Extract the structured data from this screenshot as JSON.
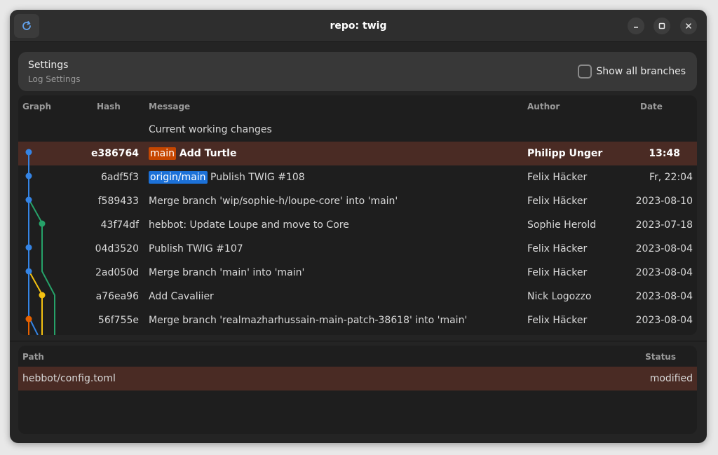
{
  "window": {
    "title": "repo: twig"
  },
  "settings": {
    "title": "Settings",
    "subtitle": "Log Settings",
    "show_all_branches_label": "Show all branches",
    "show_all_branches_checked": false
  },
  "log": {
    "columns": {
      "graph": "Graph",
      "hash": "Hash",
      "message": "Message",
      "author": "Author",
      "date": "Date"
    },
    "working_changes": "Current working changes",
    "rows": [
      {
        "hash": "e386764",
        "ref": "main",
        "message": "Add Turtle",
        "author": "Philipp Unger",
        "date": "13:48",
        "selected": true
      },
      {
        "hash": "6adf5f3",
        "ref": "origin/main",
        "message": "Publish TWIG #108",
        "author": "Felix Häcker",
        "date": "Fr, 22:04"
      },
      {
        "hash": "f589433",
        "ref": "",
        "message": "Merge branch 'wip/sophie-h/loupe-core' into 'main'",
        "author": "Felix Häcker",
        "date": "2023-08-10"
      },
      {
        "hash": "43f74df",
        "ref": "",
        "message": "hebbot: Update Loupe and move to Core",
        "author": "Sophie Herold",
        "date": "2023-07-18"
      },
      {
        "hash": "04d3520",
        "ref": "",
        "message": "Publish TWIG #107",
        "author": "Felix Häcker",
        "date": "2023-08-04"
      },
      {
        "hash": "2ad050d",
        "ref": "",
        "message": "Merge branch 'main' into 'main'",
        "author": "Felix Häcker",
        "date": "2023-08-04"
      },
      {
        "hash": "a76ea96",
        "ref": "",
        "message": "Add Cavaliier",
        "author": "Nick Logozzo",
        "date": "2023-08-04"
      },
      {
        "hash": "56f755e",
        "ref": "",
        "message": "Merge branch 'realmazharhussain-main-patch-38618' into 'main'",
        "author": "Felix Häcker",
        "date": "2023-08-04"
      }
    ]
  },
  "files": {
    "columns": {
      "path": "Path",
      "status": "Status"
    },
    "rows": [
      {
        "path": "hebbot/config.toml",
        "status": "modified"
      }
    ]
  },
  "colors": {
    "accent": "#3584e4",
    "selected_row": "#4a2b24",
    "main_tag": "#c64600",
    "origin_tag": "#1c71d8",
    "graph_blue": "#3584e4",
    "graph_green": "#26a269",
    "graph_yellow": "#f5c211",
    "graph_orange": "#e66100"
  }
}
